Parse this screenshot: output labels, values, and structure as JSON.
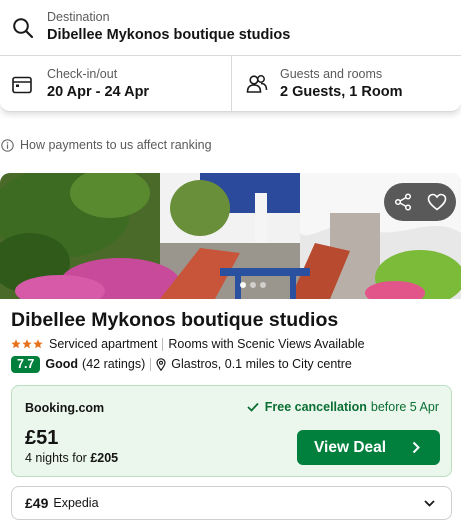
{
  "search": {
    "destination_label": "Destination",
    "destination_value": "Dibellee Mykonos boutique studios",
    "dates_label": "Check-in/out",
    "dates_value": "20 Apr - 24 Apr",
    "guests_label": "Guests and rooms",
    "guests_value": "2 Guests, 1 Room"
  },
  "info_link": "How payments to us affect ranking",
  "hotel": {
    "name": "Dibellee Mykonos boutique studios",
    "star_rating": 3,
    "type": "Serviced apartment",
    "feature": "Rooms with Scenic Views Available",
    "score": "7.7",
    "rating_word": "Good",
    "rating_count": "(42 ratings)",
    "location": "Glastros, 0.1 miles to City centre",
    "photo_count": 3,
    "active_photo": 1
  },
  "deal": {
    "provider": "Booking.com",
    "free_cancellation": "Free cancellation",
    "cancellation_date": "before 5 Apr",
    "price": "£51",
    "nights_text": "4 nights for",
    "total": "£205",
    "button_label": "View Deal"
  },
  "alt_deal": {
    "price": "£49",
    "provider": "Expedia"
  },
  "colors": {
    "accent_green": "#007f3d",
    "deal_bg": "#ebf7ec",
    "star": "#e7711b"
  }
}
